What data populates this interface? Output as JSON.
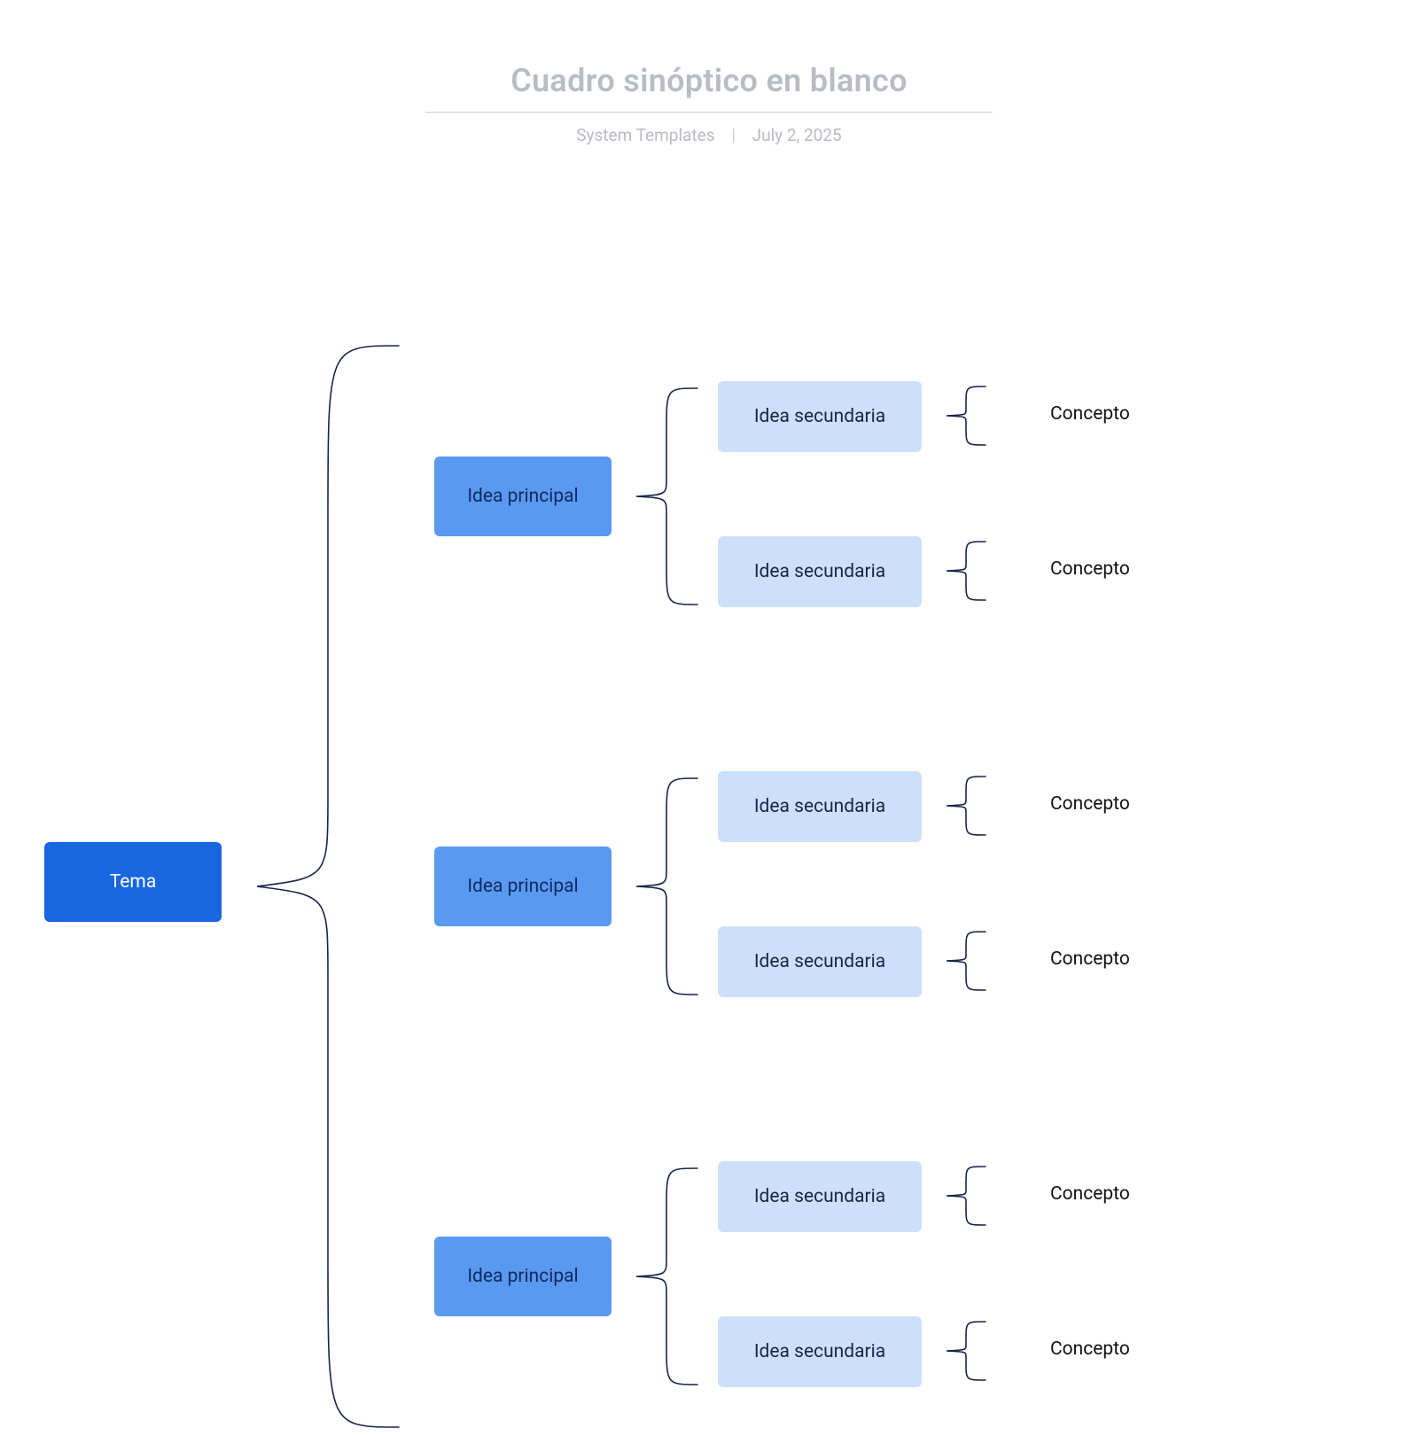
{
  "header": {
    "title": "Cuadro sinóptico en blanco",
    "source": "System Templates",
    "date": "July 2, 2025"
  },
  "root": "Tema",
  "idea_label": "Idea principal",
  "sec_label": "Idea secundaria",
  "concept_label": "Concepto",
  "colors": {
    "tema": "#1866e0",
    "idea": "#5a99f2",
    "secondary": "#cde0fb"
  }
}
